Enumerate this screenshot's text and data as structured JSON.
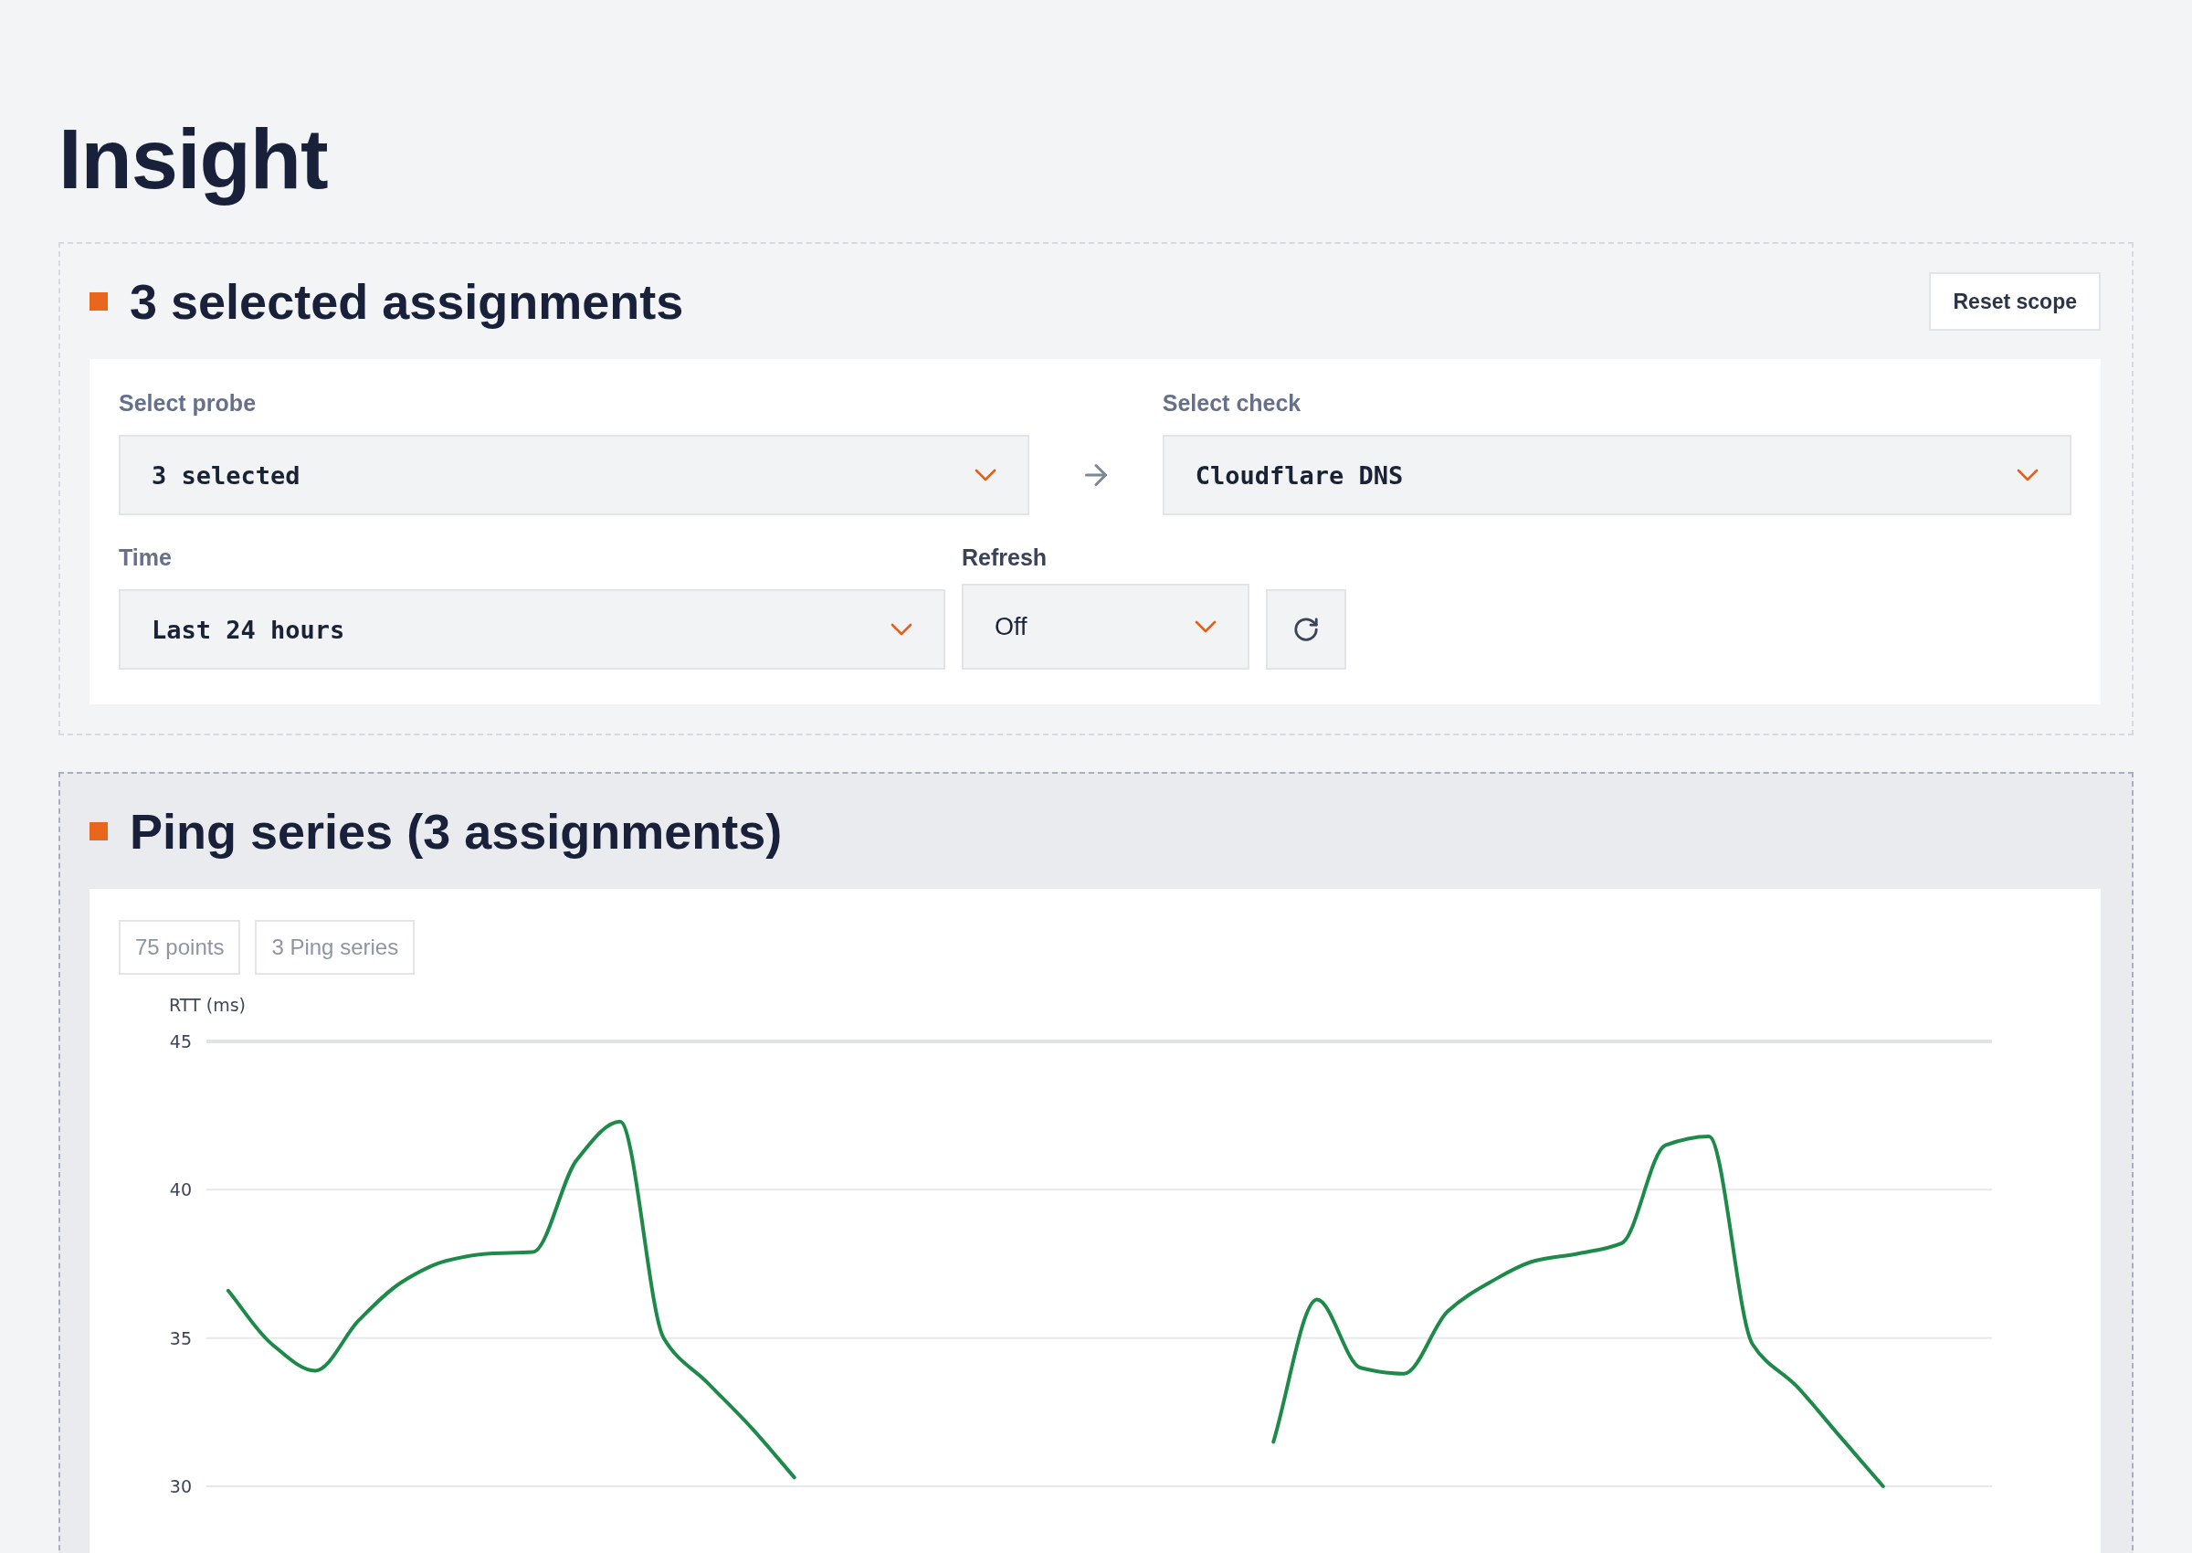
{
  "page": {
    "title": "Insight"
  },
  "scope": {
    "title": "3 selected assignments",
    "reset_button": "Reset scope",
    "probe": {
      "label": "Select probe",
      "value": "3 selected"
    },
    "check": {
      "label": "Select check",
      "value": "Cloudflare DNS"
    },
    "time": {
      "label": "Time",
      "value": "Last 24 hours"
    },
    "refresh": {
      "label": "Refresh",
      "value": "Off"
    }
  },
  "series": {
    "title": "Ping series (3 assignments)",
    "badges": [
      "75 points",
      "3 Ping series"
    ],
    "chart_data": {
      "type": "line",
      "ylabel": "RTT (ms)",
      "yticks": [
        30,
        35,
        40,
        45
      ],
      "ylim": [
        30,
        45
      ],
      "grid": true,
      "series": [
        {
          "color": "#1e8a4a",
          "values": [
            36.6,
            34.8,
            33.9,
            35.6,
            36.9,
            37.6,
            37.85,
            37.9,
            41.0,
            42.3,
            35.0,
            33.5,
            32.0,
            30.3,
            null,
            null,
            null,
            null,
            null,
            null,
            null,
            null,
            null,
            null,
            31.5,
            36.3,
            34.0,
            33.8,
            35.9,
            36.9,
            37.6,
            37.85,
            38.2,
            41.5,
            41.8,
            34.8,
            33.4,
            31.7,
            30.0,
            null,
            null
          ]
        }
      ]
    }
  }
}
